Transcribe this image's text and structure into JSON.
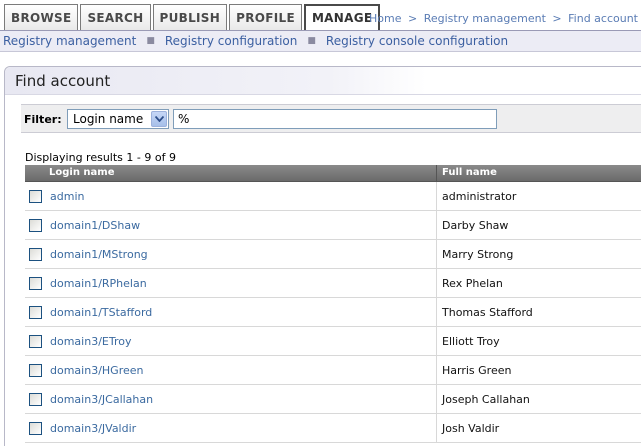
{
  "tabs": [
    {
      "label": "BROWSE",
      "active": false
    },
    {
      "label": "SEARCH",
      "active": false
    },
    {
      "label": "PUBLISH",
      "active": false
    },
    {
      "label": "PROFILE",
      "active": false
    },
    {
      "label": "MANAGE",
      "active": true
    }
  ],
  "breadcrumb": {
    "items": [
      "Home",
      "Registry management",
      "Find account"
    ],
    "separator": ">"
  },
  "submenu": {
    "items": [
      "Registry management",
      "Registry configuration",
      "Registry console configuration"
    ],
    "separator": "■"
  },
  "panel": {
    "title": "Find account"
  },
  "filter": {
    "label": "Filter:",
    "field_selected": "Login name",
    "value": "%"
  },
  "results_text": "Displaying results 1 - 9 of 9",
  "table": {
    "columns": [
      "Login name",
      "Full name"
    ],
    "rows": [
      {
        "login": "admin",
        "full_name": "administrator"
      },
      {
        "login": "domain1/DShaw",
        "full_name": "Darby Shaw"
      },
      {
        "login": "domain1/MStrong",
        "full_name": "Marry Strong"
      },
      {
        "login": "domain1/RPhelan",
        "full_name": "Rex Phelan"
      },
      {
        "login": "domain1/TStafford",
        "full_name": "Thomas Stafford"
      },
      {
        "login": "domain3/ETroy",
        "full_name": "Elliott Troy"
      },
      {
        "login": "domain3/HGreen",
        "full_name": "Harris Green"
      },
      {
        "login": "domain3/JCallahan",
        "full_name": "Joseph Callahan"
      },
      {
        "login": "domain3/JValdir",
        "full_name": "Josh Valdir"
      }
    ]
  },
  "colors": {
    "link": "#3b6aa0",
    "header_bg": "#7a7a7a",
    "submenu_bg": "#ececf5"
  }
}
